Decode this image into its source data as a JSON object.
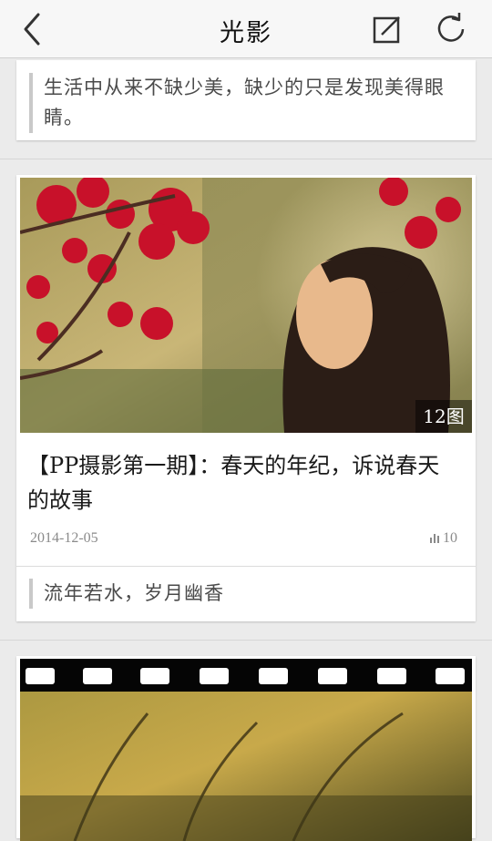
{
  "header": {
    "title": "光影",
    "back_icon": "chevron-left-icon",
    "compose_icon": "edit-icon",
    "refresh_icon": "refresh-icon"
  },
  "top_card": {
    "quote": "生活中从来不缺少美，缺少的只是发现美得眼睛。"
  },
  "post_card": {
    "image_count": "12图",
    "title": "【PP摄影第一期】：春天的年纪，诉说春天的故事",
    "date": "2014-12-05",
    "stat_icon": "bar-chart-icon",
    "stat_count": "10",
    "quote": "流年若水，岁月幽香"
  },
  "colors": {
    "background": "#ebebeb",
    "nav_background": "#f7f7f7",
    "quote_bar": "#c9c9c9",
    "meta_text": "#8a8a8a"
  }
}
